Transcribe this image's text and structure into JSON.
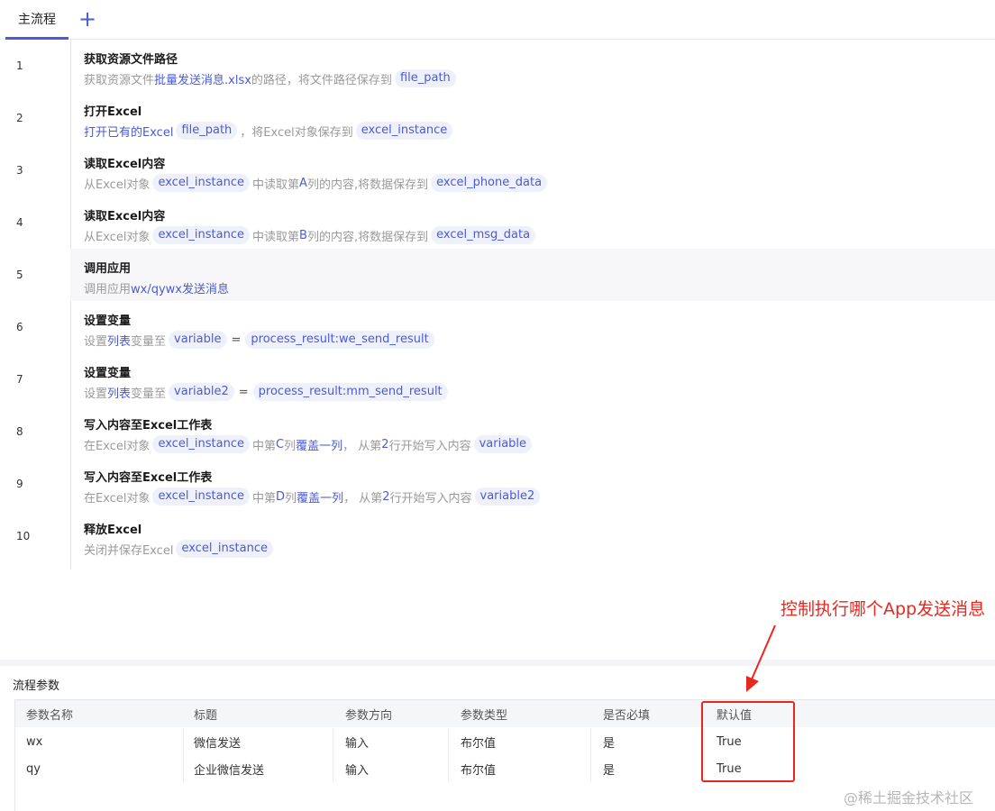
{
  "tabs": {
    "active_label": "主流程",
    "add_label": "+"
  },
  "steps": [
    {
      "num": "1",
      "title": "获取资源文件路径",
      "parts": [
        {
          "t": "text",
          "v": "获取资源文件"
        },
        {
          "t": "link",
          "v": "批量发送消息.xlsx"
        },
        {
          "t": "text",
          "v": "的路径，将文件路径保存到"
        },
        {
          "t": "var",
          "v": "file_path"
        }
      ]
    },
    {
      "num": "2",
      "title": "打开Excel",
      "parts": [
        {
          "t": "link",
          "v": "打开已有的Excel"
        },
        {
          "t": "var",
          "v": "file_path"
        },
        {
          "t": "text",
          "v": "，将Excel对象保存到"
        },
        {
          "t": "var",
          "v": "excel_instance"
        }
      ]
    },
    {
      "num": "3",
      "title": "读取Excel内容",
      "parts": [
        {
          "t": "text",
          "v": "从Excel对象"
        },
        {
          "t": "var",
          "v": "excel_instance"
        },
        {
          "t": "text",
          "v": "中读取第"
        },
        {
          "t": "link",
          "v": " A "
        },
        {
          "t": "text",
          "v": "列的内容,将数据保存到"
        },
        {
          "t": "var",
          "v": "excel_phone_data"
        }
      ]
    },
    {
      "num": "4",
      "title": "读取Excel内容",
      "parts": [
        {
          "t": "text",
          "v": "从Excel对象"
        },
        {
          "t": "var",
          "v": "excel_instance"
        },
        {
          "t": "text",
          "v": "中读取第"
        },
        {
          "t": "link",
          "v": " B "
        },
        {
          "t": "text",
          "v": "列的内容,将数据保存到"
        },
        {
          "t": "var",
          "v": "excel_msg_data"
        }
      ]
    },
    {
      "num": "5",
      "title": "调用应用",
      "highlight": true,
      "parts": [
        {
          "t": "text",
          "v": "调用应用 "
        },
        {
          "t": "link",
          "v": "wx/qywx发送消息"
        }
      ]
    },
    {
      "num": "6",
      "title": "设置变量",
      "parts": [
        {
          "t": "text",
          "v": "设置 "
        },
        {
          "t": "link",
          "v": "列表"
        },
        {
          "t": "text",
          "v": " 变量至"
        },
        {
          "t": "var",
          "v": "variable"
        },
        {
          "t": "eq",
          "v": "="
        },
        {
          "t": "var",
          "v": "process_result:we_send_result"
        }
      ]
    },
    {
      "num": "7",
      "title": "设置变量",
      "parts": [
        {
          "t": "text",
          "v": "设置 "
        },
        {
          "t": "link",
          "v": "列表"
        },
        {
          "t": "text",
          "v": " 变量至"
        },
        {
          "t": "var",
          "v": "variable2"
        },
        {
          "t": "eq",
          "v": "="
        },
        {
          "t": "var",
          "v": "process_result:mm_send_result"
        }
      ]
    },
    {
      "num": "8",
      "title": "写入内容至Excel工作表",
      "parts": [
        {
          "t": "text",
          "v": "在Excel对象"
        },
        {
          "t": "var",
          "v": "excel_instance"
        },
        {
          "t": "text",
          "v": "中第"
        },
        {
          "t": "link",
          "v": " C "
        },
        {
          "t": "text",
          "v": "列 "
        },
        {
          "t": "link",
          "v": "覆盖一列"
        },
        {
          "t": "text",
          "v": "， 从第"
        },
        {
          "t": "link",
          "v": " 2 "
        },
        {
          "t": "text",
          "v": "行开始写入内容"
        },
        {
          "t": "var",
          "v": "variable"
        }
      ]
    },
    {
      "num": "9",
      "title": "写入内容至Excel工作表",
      "parts": [
        {
          "t": "text",
          "v": "在Excel对象"
        },
        {
          "t": "var",
          "v": "excel_instance"
        },
        {
          "t": "text",
          "v": "中第"
        },
        {
          "t": "link",
          "v": " D "
        },
        {
          "t": "text",
          "v": "列 "
        },
        {
          "t": "link",
          "v": "覆盖一列"
        },
        {
          "t": "text",
          "v": "， 从第"
        },
        {
          "t": "link",
          "v": " 2 "
        },
        {
          "t": "text",
          "v": "行开始写入内容"
        },
        {
          "t": "var",
          "v": "variable2"
        }
      ]
    },
    {
      "num": "10",
      "title": "释放Excel",
      "parts": [
        {
          "t": "text",
          "v": "关闭并保存Excel"
        },
        {
          "t": "var",
          "v": "excel_instance"
        }
      ]
    }
  ],
  "annotation": {
    "text": "控制执行哪个App发送消息",
    "color": "#e8271f"
  },
  "params": {
    "title": "流程参数",
    "headers": [
      "参数名称",
      "标题",
      "参数方向",
      "参数类型",
      "是否必填",
      "默认值"
    ],
    "rows": [
      [
        "wx",
        "微信发送",
        "输入",
        "布尔值",
        "是",
        "True"
      ],
      [
        "qy",
        "企业微信发送",
        "输入",
        "布尔值",
        "是",
        "True"
      ]
    ]
  },
  "watermark": "@稀土掘金技术社区",
  "colors": {
    "accent": "#4a5bd4",
    "var_bg": "#eef0fc",
    "annotation_red": "#e8271f"
  }
}
